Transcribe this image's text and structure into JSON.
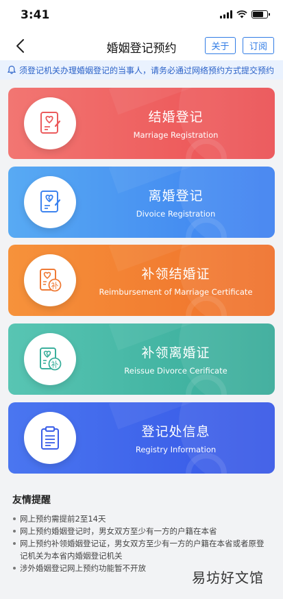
{
  "status": {
    "time": "3:41",
    "battery_level": 0.75
  },
  "nav": {
    "title": "婚姻登记预约",
    "about": "关于",
    "subscribe": "订阅"
  },
  "notice": {
    "text": "须登记机关办理婚姻登记的当事人，请务必通过网络预约方式提交预约"
  },
  "cards": [
    {
      "cn": "结婚登记",
      "en": "Marriage Registration",
      "icon": "marriage-certificate-icon"
    },
    {
      "cn": "离婚登记",
      "en": "Divoice Registration",
      "icon": "divorce-certificate-icon"
    },
    {
      "cn": "补领结婚证",
      "en": "Reimbursement of Marriage Certificate",
      "icon": "reissue-marriage-icon",
      "badge": "补"
    },
    {
      "cn": "补领离婚证",
      "en": "Reissue Divorce Cerificate",
      "icon": "reissue-divorce-icon",
      "badge": "补"
    },
    {
      "cn": "登记处信息",
      "en": "Registry Information",
      "icon": "clipboard-icon"
    }
  ],
  "tips": {
    "title": "友情提醒",
    "items": [
      "网上预约需提前2至14天",
      "网上预约婚姻登记时，男女双方至少有一方的户籍在本省",
      "网上预约补领婚姻登记证，男女双方至少有一方的户籍在本省或者原登记机关为本省内婚姻登记机关",
      "涉外婚姻登记网上预约功能暂不开放"
    ]
  },
  "watermark": "易坊好文馆",
  "colors": {
    "accent": "#2f7be5",
    "marriage": "#eb4f52",
    "divorce": "#3c7ff0",
    "reissue_marriage": "#ef6f2a",
    "reissue_divorce": "#36aa98",
    "registry": "#3656e6"
  }
}
